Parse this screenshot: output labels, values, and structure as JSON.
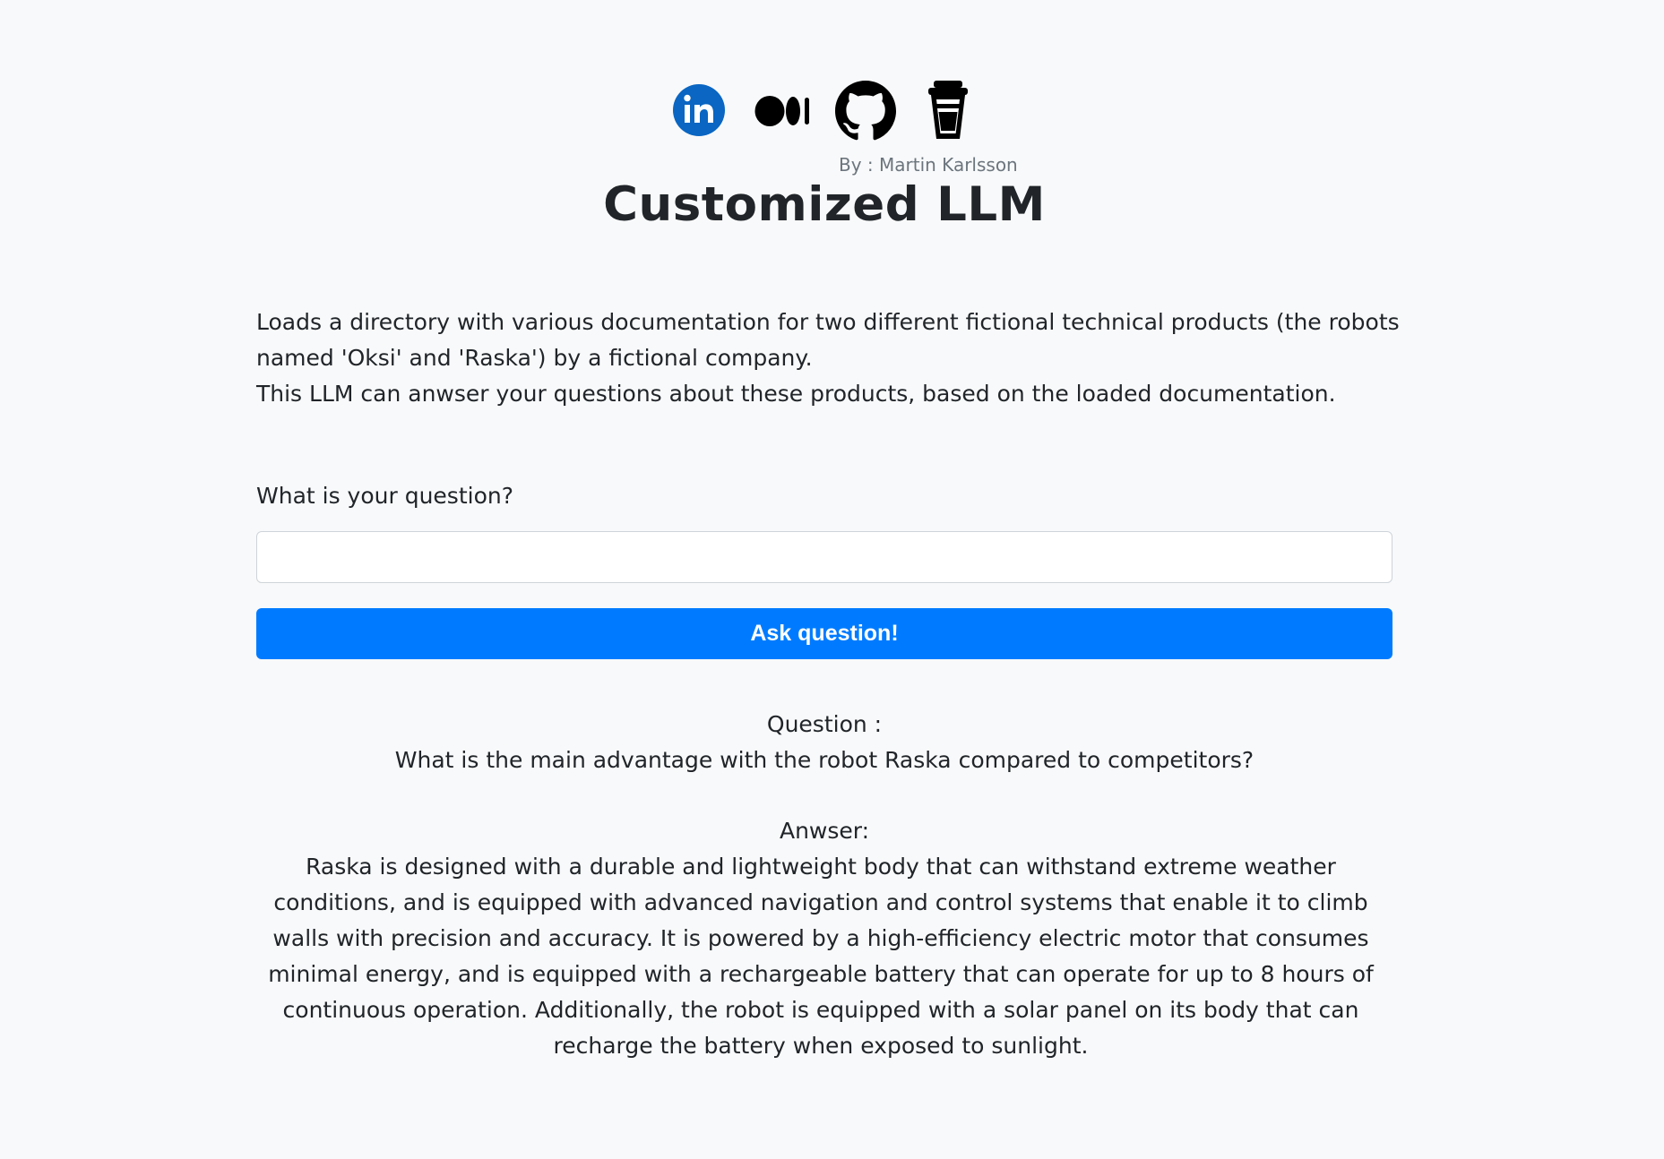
{
  "header": {
    "social_links": [
      {
        "name": "linkedin",
        "icon": "linkedin-icon",
        "color": "#0a66c2"
      },
      {
        "name": "medium",
        "icon": "medium-icon",
        "color": "#000000"
      },
      {
        "name": "github",
        "icon": "github-icon",
        "color": "#000000"
      },
      {
        "name": "buy-me-a-coffee",
        "icon": "coffee-cup-icon",
        "color": "#000000"
      }
    ],
    "byline": "By : Martin Karlsson",
    "title": "Customized LLM"
  },
  "description": {
    "line1": "Loads a directory with various documentation for two different fictional technical products (the robots named 'Oksi' and 'Raska') by a fictional company.",
    "line2": "This LLM can anwser your questions about these products, based on the loaded documentation."
  },
  "form": {
    "question_label": "What is your question?",
    "question_value": "",
    "question_placeholder": "",
    "ask_button_label": "Ask question!"
  },
  "result": {
    "question_heading": "Question :",
    "question_text": "What is the main advantage with the robot Raska compared to competitors?",
    "answer_heading": "Anwser:",
    "answer_text": "Raska is designed with a durable and lightweight body that can withstand extreme weather conditions, and is equipped with advanced navigation and control systems that enable it to climb walls with precision and accuracy. It is powered by a high-efficiency electric motor that consumes minimal energy, and is equipped with a rechargeable battery that can operate for up to 8 hours of continuous operation. Additionally, the robot is equipped with a solar panel on its body that can recharge the battery when exposed to sunlight."
  },
  "colors": {
    "background": "#f8f9fa",
    "primary_button": "#007bff",
    "text": "#212529",
    "muted_text": "#6c757d"
  }
}
